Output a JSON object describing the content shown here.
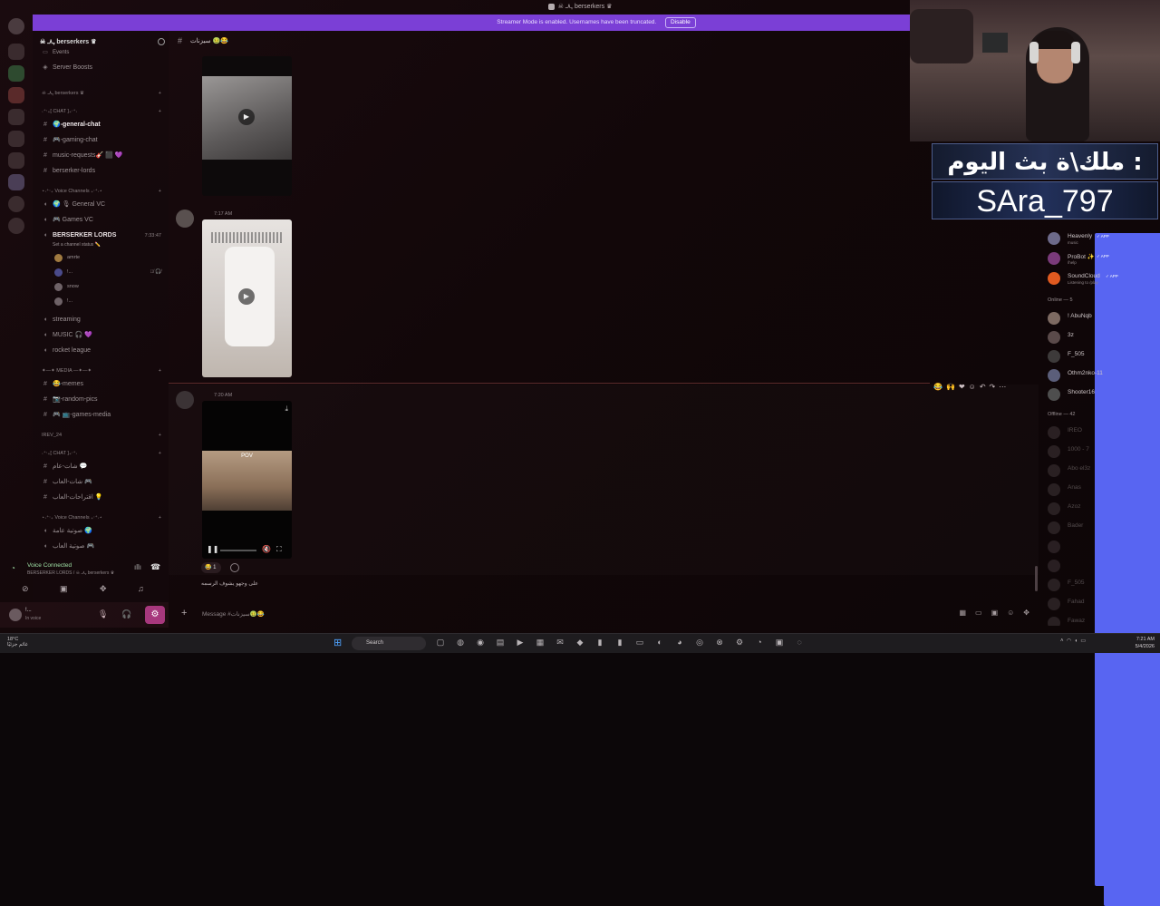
{
  "window": {
    "title": "☠ ﮩ٨ـ berserkers ♛",
    "banner_text": "Streamer Mode is enabled. Usernames have been truncated.",
    "banner_button": "Disable"
  },
  "server": {
    "name": "☠ ﮩ٨ـ berserkers ♛",
    "top_items": [
      "Events",
      "Server Boosts"
    ]
  },
  "channels": [
    {
      "kind": "cat",
      "label": "☠ ﮩ٨ـ berserkers ♛"
    },
    {
      "kind": "cat",
      "label": "˖⁺‧₊[ CHAT ]₊‧⁺˖"
    },
    {
      "kind": "text",
      "label": "🌍-general-chat",
      "active": true
    },
    {
      "kind": "text",
      "label": "🎮-gaming-chat"
    },
    {
      "kind": "text",
      "label": "music-requests🎸 ⬛ 💜"
    },
    {
      "kind": "text",
      "label": "berserker-lords"
    },
    {
      "kind": "cat",
      "label": "⋆˖⁺‧₊ Voice Channels ₊‧⁺˖⋆"
    },
    {
      "kind": "voice",
      "label": "🌍 🎙 General VC"
    },
    {
      "kind": "voice",
      "label": "🎮 Games VC"
    },
    {
      "kind": "voice-big",
      "label": "BERSERKER LORDS",
      "time": "7:33:47",
      "status": "Set a channel status ✏️"
    },
    {
      "kind": "user",
      "label": "amrte"
    },
    {
      "kind": "user",
      "label": "!..."
    },
    {
      "kind": "user",
      "label": "snow"
    },
    {
      "kind": "user",
      "label": "!..."
    },
    {
      "kind": "voice",
      "label": "streaming"
    },
    {
      "kind": "voice",
      "label": "MUSIC 🎧 💜"
    },
    {
      "kind": "voice",
      "label": "rocket league"
    },
    {
      "kind": "cat",
      "label": "✦—✦ MEDIA —✦—✦"
    },
    {
      "kind": "text",
      "label": "😂-memes"
    },
    {
      "kind": "text",
      "label": "📷-random-pics"
    },
    {
      "kind": "text",
      "label": "🎮 📺-games-media"
    },
    {
      "kind": "cat",
      "label": "IREV_24"
    },
    {
      "kind": "cat",
      "label": "˖⁺‧₊[ CHAT ]₊‧⁺˖"
    },
    {
      "kind": "text",
      "label": "شات-عام 💬"
    },
    {
      "kind": "text",
      "label": "شات-العاب 🎮"
    },
    {
      "kind": "text",
      "label": "اقتراحات-العاب 💡"
    },
    {
      "kind": "cat",
      "label": "⋆˖⁺‧₊ Voice Channels ₊‧⁺˖⋆"
    },
    {
      "kind": "voice",
      "label": "صوتية عامة 🌍"
    },
    {
      "kind": "voice",
      "label": "صوتية العاب 🎮"
    }
  ],
  "voice_panel": {
    "title": "Voice Connected",
    "subtitle": "BERSERKER LORDS / ☠ ﮩ٨ـ berserkers ♛"
  },
  "user_panel": {
    "name": "!...",
    "status": "In voice"
  },
  "chat": {
    "channel": "سيزنات 🤢😂",
    "messages": [
      {
        "time": "7:17 AM"
      },
      {
        "time": "7:20 AM",
        "video_text": "POV",
        "reaction": "😂 1",
        "caption": "على وجهو يشوف الرسمه"
      }
    ],
    "composer_placeholder": "Message #سيزنات🤢😂"
  },
  "overlay": {
    "line1": "ملك\\ة بث اليوم :",
    "line2": "SAra_797"
  },
  "members": {
    "bots": [
      {
        "name": "Heavenly",
        "sub": "music",
        "tag": "✓ APP"
      },
      {
        "name": "ProBot ✨",
        "sub": "/help",
        "tag": "✓ APP"
      },
      {
        "name": "SoundCloud",
        "sub": "Listening to /play",
        "tag": "✓ APP"
      }
    ],
    "online_header": "Online — 5",
    "online": [
      "! AbuNqb",
      "3z",
      "F_505",
      "Othm2nko-11",
      "Shooter16"
    ],
    "offline_header": "Offline — 42",
    "offline": [
      "IREO",
      "1000 - 7",
      "Abo el3z",
      "Anas",
      "Azoz",
      "Bader",
      "",
      "",
      "F_505",
      "Fahad",
      "Fawaz"
    ]
  },
  "taskbar": {
    "weather": "18°C",
    "weather_sub": "غائم جزئيًا",
    "search": "Search",
    "time": "7:21 AM",
    "date": "5/4/2026"
  }
}
